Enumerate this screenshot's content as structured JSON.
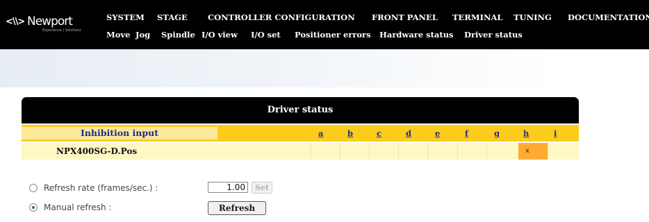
{
  "brand": {
    "name": "Newport",
    "tagline": "Experience | Solutions"
  },
  "nav": {
    "main": [
      "SYSTEM",
      "STAGE",
      "CONTROLLER CONFIGURATION",
      "FRONT PANEL",
      "TERMINAL",
      "TUNING",
      "DOCUMENTATION"
    ],
    "sub": [
      "Move",
      "Jog",
      "Spindle",
      "I/O view",
      "I/O set",
      "Positioner errors",
      "Hardware status",
      "Driver status"
    ]
  },
  "panel": {
    "title": "Driver status",
    "header_label": "Inhibition input",
    "columns": [
      "a",
      "b",
      "c",
      "d",
      "e",
      "f",
      "g",
      "h",
      "i"
    ],
    "rows": [
      {
        "label": "NPX400SG-D.Pos",
        "active_column": "h",
        "mark": "x"
      }
    ]
  },
  "refresh": {
    "rate_label": "Refresh rate (frames/sec.) :",
    "rate_value": "1.00",
    "set_label": "Set",
    "manual_label": "Manual refresh :",
    "refresh_label": "Refresh",
    "selected": "manual"
  },
  "colors": {
    "nav_bg": "#000000",
    "header_row": "#fccc1c",
    "data_row": "#fef8c4",
    "active_cell": "#fdac31",
    "link": "#1c2c8c"
  }
}
